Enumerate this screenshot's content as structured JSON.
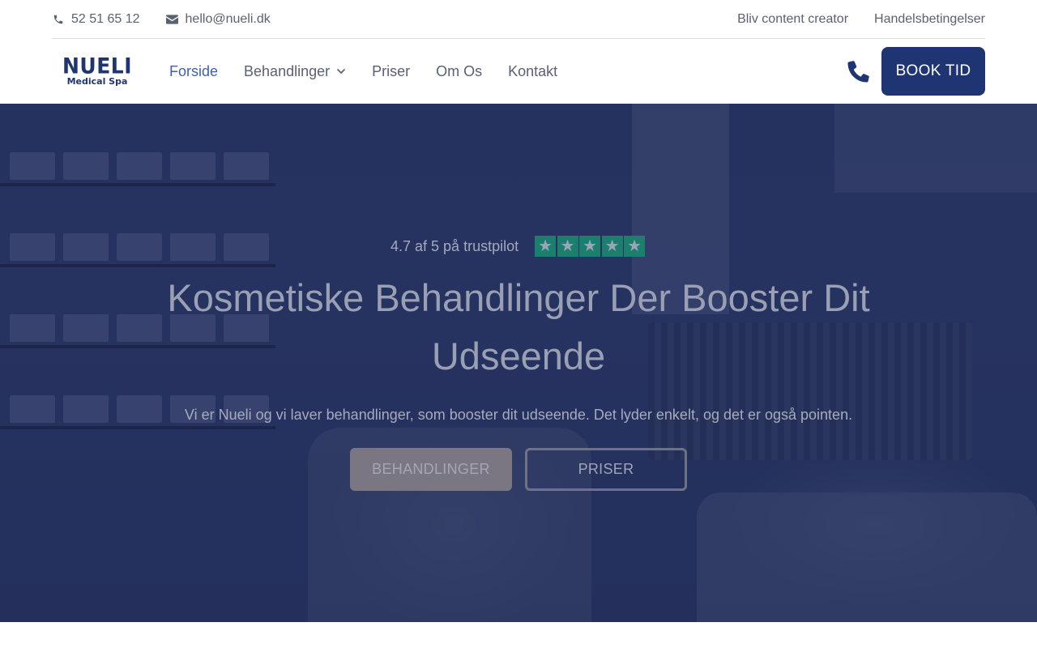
{
  "topbar": {
    "phone": "52 51 65 12",
    "email": "hello@nueli.dk",
    "links": [
      "Bliv content creator",
      "Handelsbetingelser"
    ]
  },
  "logo": {
    "main": "NUELI",
    "sub": "Medical Spa"
  },
  "nav": {
    "items": [
      "Forside",
      "Behandlinger",
      "Priser",
      "Om Os",
      "Kontakt"
    ],
    "active": "Forside"
  },
  "header": {
    "book_label": "BOOK TID"
  },
  "hero": {
    "rating_text": "4.7 af 5 på trustpilot",
    "rating_value": 4.7,
    "rating_max": 5,
    "title": "Kosmetiske Behandlinger Der Booster Dit Udseende",
    "subtitle": "Vi er Nueli og vi laver behandlinger, som booster dit udseende. Det lyder enkelt, og det er også pointen.",
    "primary_button": "BEHANDLINGER",
    "secondary_button": "PRISER"
  },
  "colors": {
    "brand": "#1f3473",
    "active_nav": "#3f5fb0",
    "trustpilot_green": "#1c7f6e"
  }
}
